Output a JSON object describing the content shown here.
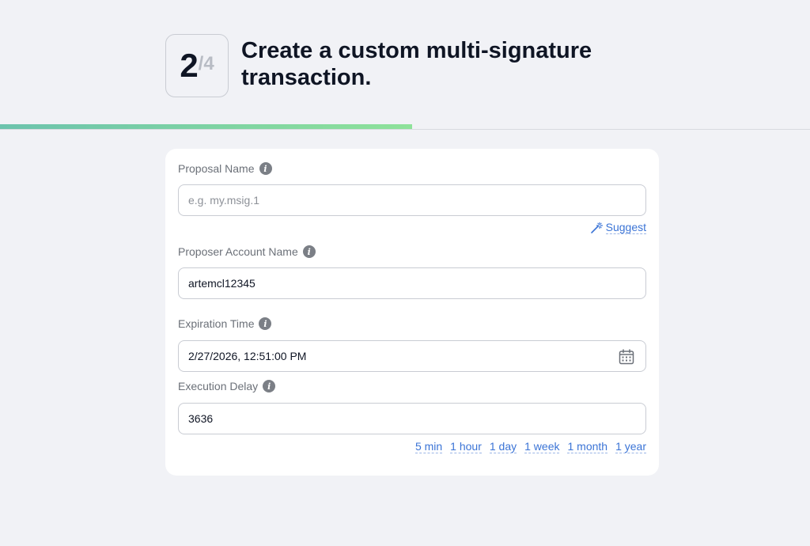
{
  "header": {
    "step_current": "2",
    "step_total": "/4",
    "title": "Create a custom multi-signature transaction."
  },
  "progress": {
    "fraction": 0.5
  },
  "form": {
    "proposal_name": {
      "label": "Proposal Name",
      "value": "",
      "placeholder": "e.g. my.msig.1",
      "suggest_label": "Suggest"
    },
    "proposer_account": {
      "label": "Proposer Account Name",
      "value": "artemcl12345"
    },
    "expiration_time": {
      "label": "Expiration Time",
      "value": "2/27/2026, 12:51:00 PM"
    },
    "execution_delay": {
      "label": "Execution Delay",
      "value": "3636",
      "presets": [
        "5 min",
        "1 hour",
        "1 day",
        "1 week",
        "1 month",
        "1 year"
      ]
    }
  },
  "colors": {
    "accent_link": "#3b74d6",
    "progress_start": "#6cc3ad",
    "progress_end": "#8ee29a",
    "background": "#f1f2f6"
  },
  "icons": {
    "info": "info-icon",
    "suggest": "magic-wand-icon",
    "calendar": "calendar-icon"
  }
}
